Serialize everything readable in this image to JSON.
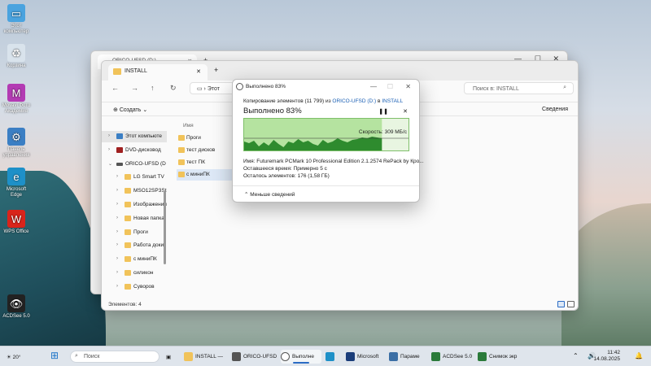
{
  "desktop": {
    "icons": [
      {
        "name": "this-pc-icon",
        "label": "Этот компьютер"
      },
      {
        "name": "recycle-bin-icon",
        "label": "Корзина"
      },
      {
        "name": "photo-app-icon",
        "label": "Movavi Фото Академия"
      },
      {
        "name": "control-panel-icon",
        "label": "Панель управления"
      },
      {
        "name": "edge-icon",
        "label": "Microsoft Edge"
      },
      {
        "name": "wps-office-icon",
        "label": "WPS Office"
      },
      {
        "name": "acdsee-icon",
        "label": "ACDSee 5.0"
      }
    ]
  },
  "back_window": {
    "tab_title": "ORICO-UFSD (D:)"
  },
  "explorer": {
    "tab_title": "INSTALL",
    "address": "Этот",
    "search_placeholder": "Поиск в: INSTALL",
    "create_label": "Создать",
    "details_label": "Сведения",
    "column_name": "Имя",
    "sidebar": [
      {
        "label": "Этот компьюте",
        "level": 0,
        "kind": "pc",
        "selected": true
      },
      {
        "label": "DVD-дисковод",
        "level": 0,
        "kind": "dvd"
      },
      {
        "label": "ORICO-UFSD (D",
        "level": 0,
        "kind": "drive"
      },
      {
        "label": "LG Smart TV",
        "level": 1,
        "kind": "folder"
      },
      {
        "label": "MSO12SP3StiR",
        "level": 1,
        "kind": "folder"
      },
      {
        "label": "Изображения",
        "level": 1,
        "kind": "folder"
      },
      {
        "label": "Новая папка",
        "level": 1,
        "kind": "folder"
      },
      {
        "label": "Проги",
        "level": 1,
        "kind": "folder"
      },
      {
        "label": "Работа доки",
        "level": 1,
        "kind": "folder"
      },
      {
        "label": "с миниПК",
        "level": 1,
        "kind": "folder"
      },
      {
        "label": "силикон",
        "level": 1,
        "kind": "folder"
      },
      {
        "label": "Суворов",
        "level": 1,
        "kind": "folder"
      }
    ],
    "files": [
      {
        "label": "Проги",
        "selected": false
      },
      {
        "label": "тест дисков",
        "selected": false
      },
      {
        "label": "тест ПК",
        "selected": false
      },
      {
        "label": "с миниПК",
        "selected": true
      }
    ],
    "status": "Элементов: 4"
  },
  "copy_dialog": {
    "title": "Выполнено 83%",
    "sub_prefix": "Копирование элементов (11 799) из",
    "source": "ORICO-UFSD (D:)",
    "sub_mid": "в",
    "dest": "INSTALL",
    "heading": "Выполнено 83%",
    "progress_percent": 83,
    "speed": "Скорость: 309 МБ/с",
    "name_line": "Имя: Futuremark PCMark 10 Professional Edition 2.1.2574 RePack by Кро...",
    "time_line": "Оставшееся время: Примерно 5 с",
    "items_line": "Осталось элементов: 176 (1,58 ГБ)",
    "less_label": "Меньше сведений",
    "pause_icon": "pause-icon",
    "graph_color": "#2e8b2e",
    "graph_fill": "#6fbf4f"
  },
  "taskbar": {
    "weather": "20°",
    "search_placeholder": "Поиск",
    "items": [
      {
        "name": "taskbar-explorer-install",
        "label": "INSTALL — ",
        "color": "#f1c35a"
      },
      {
        "name": "taskbar-orico",
        "label": "ORICO-UFSD",
        "color": "#555555"
      },
      {
        "name": "taskbar-copy-progress",
        "label": "Выполне",
        "color": "#ffffff",
        "active": true
      },
      {
        "name": "taskbar-edge",
        "label": "",
        "color": "#1e90c8"
      },
      {
        "name": "taskbar-microsoft-store",
        "label": "Microsoft",
        "color": "#1a3d7a"
      },
      {
        "name": "taskbar-settings",
        "label": "Параме",
        "color": "#3a6ea5"
      },
      {
        "name": "taskbar-acdsee",
        "label": "ACDSee 5.0",
        "color": "#2a7a3a"
      },
      {
        "name": "taskbar-snipping",
        "label": "Снимок экр",
        "color": "#2a7a3a"
      }
    ],
    "time": "11:42",
    "date": "14.08.2025"
  }
}
